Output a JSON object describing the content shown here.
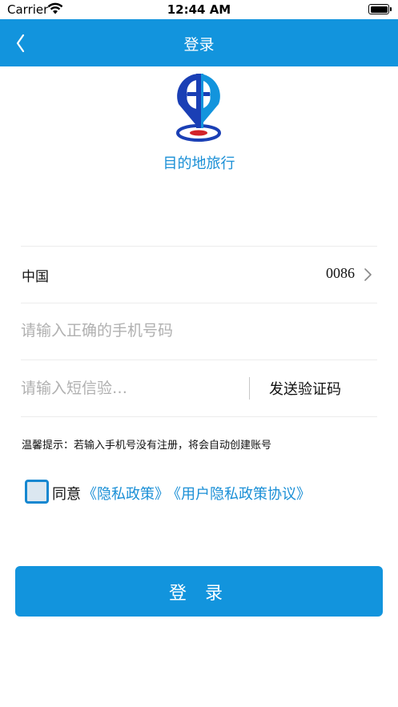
{
  "status_bar": {
    "carrier": "Carrier",
    "time": "12:44 AM"
  },
  "nav": {
    "title": "登录",
    "back_icon": "chevron-left-icon"
  },
  "brand": {
    "app_name": "目的地旅行",
    "logo_colors": [
      "#1a3fb5",
      "#1294dd",
      "#d2232a"
    ]
  },
  "form": {
    "country_label": "中国",
    "country_code": "0086",
    "phone_placeholder": "请输入正确的手机号码",
    "code_placeholder": "请输入短信验…",
    "send_code_label": "发送验证码",
    "hint": "温馨提示：若输入手机号没有注册，将会自动创建账号"
  },
  "agreement": {
    "agree_label": "同意",
    "privacy_link": "《隐私政策》",
    "user_link": "《用户隐私政策协议》",
    "checked": false
  },
  "login_button": "登 录",
  "colors": {
    "accent": "#1294dd",
    "link": "#1a8fd6"
  }
}
